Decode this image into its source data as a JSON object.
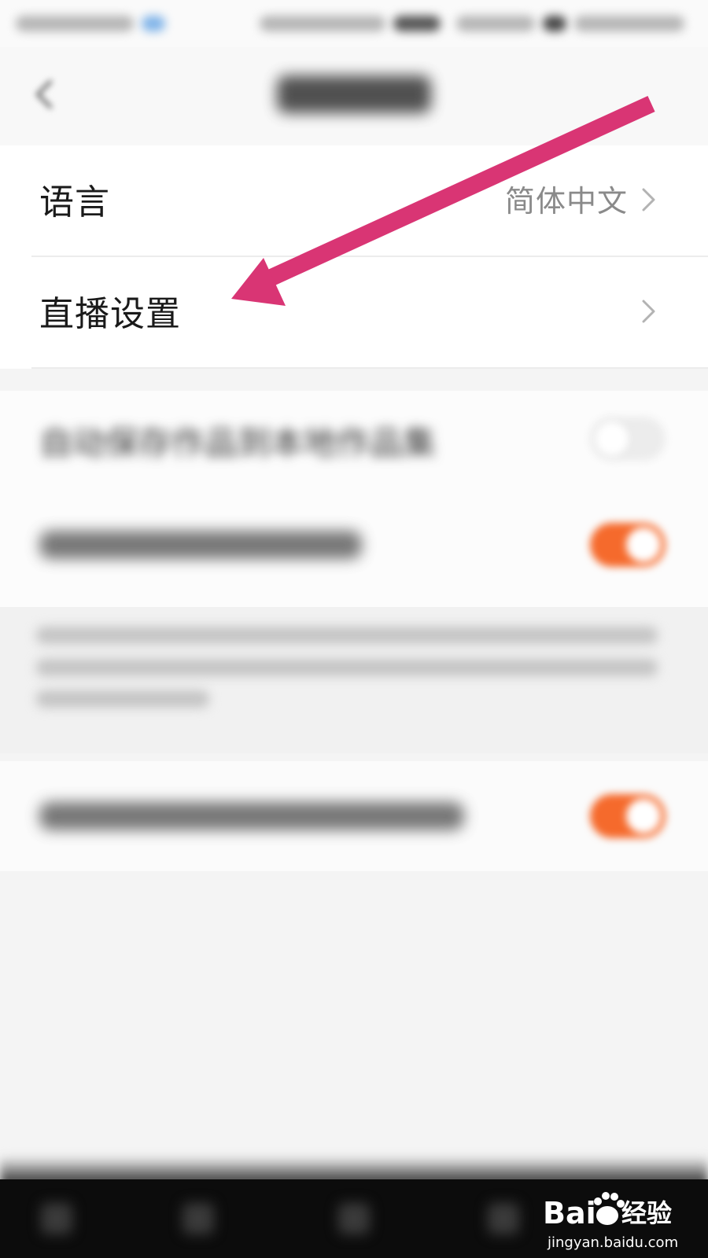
{
  "settings": {
    "language_label": "语言",
    "language_value": "简体中文",
    "live_settings_label": "直播设置"
  },
  "blurred_options": {
    "auto_save_label": "自动保存作品到本地作品集",
    "auto_save_toggle_on": false,
    "wifi_upload_toggle_on": true,
    "third_toggle_on": true
  },
  "watermark": {
    "text": "jingyan.baidu.com"
  },
  "colors": {
    "arrow": "#d93574",
    "toggle_on": "#f56a2c"
  }
}
